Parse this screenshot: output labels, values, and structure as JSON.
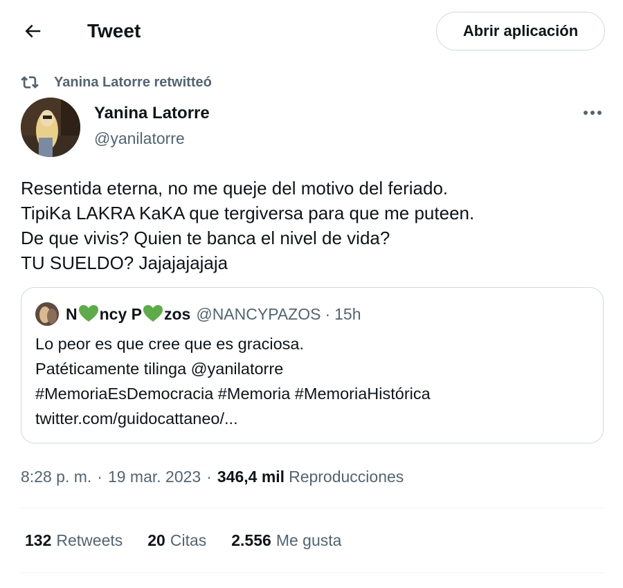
{
  "header": {
    "title": "Tweet",
    "back_icon": "arrow-left-icon",
    "open_app_label": "Abrir aplicación"
  },
  "retweet": {
    "icon": "retweet-icon",
    "label": "Yanina Latorre retwitteó"
  },
  "author": {
    "name": "Yanina Latorre",
    "handle": "@yanilatorre",
    "more_icon": "more-dots-icon"
  },
  "tweet": {
    "lines": [
      "Resentida eterna, no me queje del motivo del feriado.",
      "TipiKa LAKRA KaKA que tergiversa para que me puteen.",
      "De que vivis? Quien te banca el nivel de vida?",
      "TU SUELDO? Jajajajajaja"
    ]
  },
  "quote": {
    "name_parts": [
      "N",
      "ncy P",
      "zos"
    ],
    "heart_color": "#4caf50",
    "handle": "@NANCYPAZOS",
    "separator": "·",
    "time": "15h",
    "lines": [
      "Lo peor es que cree que es graciosa.",
      "Patéticamente tilinga @yanilatorre",
      "#MemoriaEsDemocracia #Memoria #MemoriaHistórica",
      "twitter.com/guidocattaneo/..."
    ]
  },
  "meta": {
    "time": "8:28 p. m.",
    "separator": "·",
    "date": "19 mar. 2023",
    "views_count": "346,4 mil",
    "views_label": "Reproducciones"
  },
  "stats": {
    "retweets_count": "132",
    "retweets_label": "Retweets",
    "quotes_count": "20",
    "quotes_label": "Citas",
    "likes_count": "2.556",
    "likes_label": "Me gusta"
  },
  "colors": {
    "text": "#0f1419",
    "secondary": "#536471",
    "border": "#cfd9de",
    "divider": "#eff3f4"
  }
}
